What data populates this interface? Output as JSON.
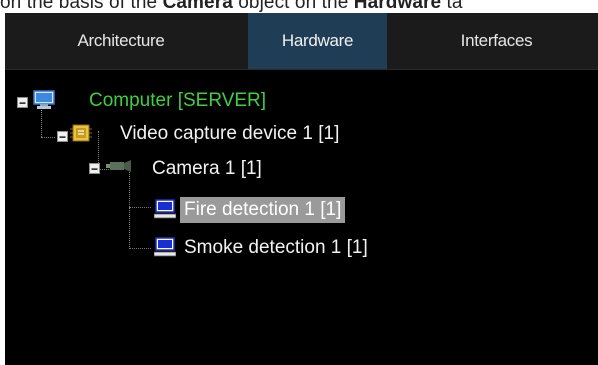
{
  "caption": {
    "part1": "on the basis of the ",
    "bold1": "Camera",
    "part2": " object on the ",
    "bold2": "Hardware",
    "part3": " ta"
  },
  "tabs": [
    {
      "label": "Architecture",
      "active": false
    },
    {
      "label": "Hardware",
      "active": true
    },
    {
      "label": "Interfaces",
      "active": false
    }
  ],
  "tree": {
    "root": {
      "label": "Computer [SERVER]",
      "icon": "computer-icon",
      "color": "#3fcf3f"
    },
    "capture": {
      "label": "Video capture device 1 [1]",
      "icon": "capture-device-icon"
    },
    "camera": {
      "label": "Camera 1 [1]",
      "icon": "camera-icon"
    },
    "fire": {
      "label": "Fire detection 1 [1]",
      "icon": "detector-icon",
      "selected": true
    },
    "smoke": {
      "label": "Smoke detection 1 [1]",
      "icon": "detector-icon"
    }
  },
  "colors": {
    "background": "#000000",
    "tab_bar": "#1b1b1b",
    "active_tab": "#1f3e55",
    "selection": "#9a9a9a"
  }
}
